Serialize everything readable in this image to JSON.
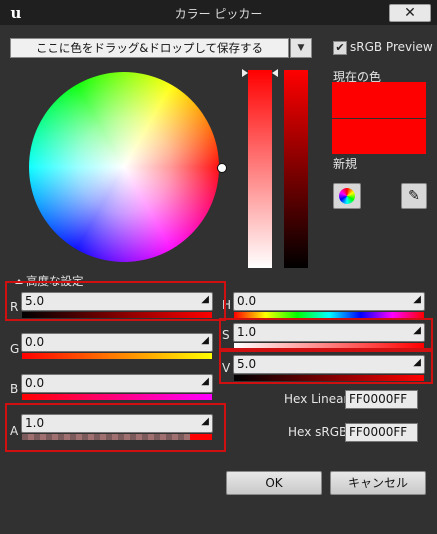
{
  "window": {
    "title": "カラー ピッカー",
    "close_label": "✕",
    "logo": "u"
  },
  "toolbar": {
    "dropdown_text": "ここに色をドラッグ&ドロップして保存する",
    "dropdown_arrow": "▼",
    "srgb_checked": "✔",
    "srgb_label": "sRGB Preview"
  },
  "swatches": {
    "current_label": "現在の色",
    "new_label": "新規",
    "current_color": "#ff0000",
    "new_color": "#ff0000"
  },
  "advanced": {
    "label": "高度な設定"
  },
  "channels": {
    "r": {
      "label": "R",
      "value": "5.0"
    },
    "g": {
      "label": "G",
      "value": "0.0"
    },
    "b": {
      "label": "B",
      "value": "0.0"
    },
    "a": {
      "label": "A",
      "value": "1.0"
    },
    "h": {
      "label": "H",
      "value": "0.0"
    },
    "s": {
      "label": "S",
      "value": "1.0"
    },
    "v": {
      "label": "V",
      "value": "5.0"
    }
  },
  "field_arrow": "◢",
  "hex": {
    "linear_label": "Hex Linear",
    "linear_value": "FF0000FF",
    "srgb_label": "Hex sRGB",
    "srgb_value": "FF0000FF"
  },
  "buttons": {
    "ok": "OK",
    "cancel": "キャンセル"
  },
  "icons": {
    "close": "close-icon",
    "dropdown": "chevron-down-icon",
    "wheel": "color-wheel-icon",
    "eyedropper": "eyedropper-icon"
  }
}
